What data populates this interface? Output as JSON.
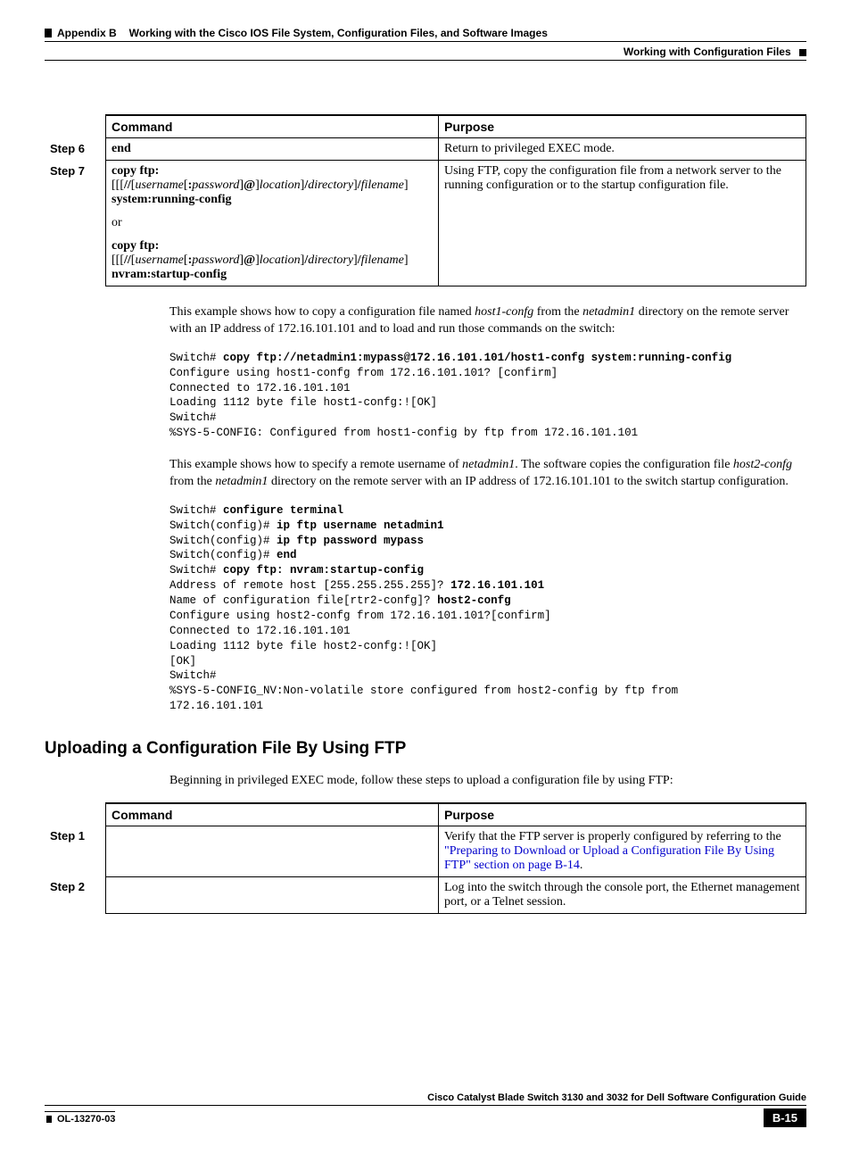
{
  "header": {
    "appendix": "Appendix B",
    "title": "Working with the Cisco IOS File System, Configuration Files, and Software Images",
    "section": "Working with Configuration Files"
  },
  "table1": {
    "headers": {
      "command": "Command",
      "purpose": "Purpose"
    },
    "rows": [
      {
        "step": "Step 6",
        "command_html": "<p><span class='bold'>end</span></p>",
        "purpose": "Return to privileged EXEC mode."
      },
      {
        "step": "Step 7",
        "command_html": "<p><span class='bold'>copy ftp:</span>[[[<span class='bold'>//</span>[<span class='italic'>username</span>[<span class='bold'>:</span><span class='italic'>password</span>]<span class='bold'>@</span>]<span class='italic'>location</span>]<span class='bold'>/</span><span class='italic'>directory</span>]<span class='bold'>/</span><span class='italic'>filename</span>] <span class='bold'>system:running-config</span></p><p>or</p><p><span class='bold'>copy ftp:</span>[[[<span class='bold'>//</span>[<span class='italic'>username</span>[<span class='bold'>:</span><span class='italic'>password</span>]<span class='bold'>@</span>]<span class='italic'>location</span>]<span class='bold'>/</span><span class='italic'>directory</span>]<span class='bold'>/</span><span class='italic'>filename</span>] <span class='bold'>nvram:startup-config</span></p>",
        "purpose": "Using FTP, copy the configuration file from a network server to the running configuration or to the startup configuration file."
      }
    ]
  },
  "para1_parts": {
    "p1": "This example shows how to copy a configuration file named ",
    "i1": "host1-confg",
    "p2": " from the ",
    "i2": "netadmin1",
    "p3": " directory on the remote server with an IP address of 172.16.101.101 and to load and run those commands on the switch:"
  },
  "code1": "Switch# <b>copy ftp://netadmin1:mypass@172.16.101.101/host1-confg system:running-config</b>\nConfigure using host1-confg from 172.16.101.101? [confirm]\nConnected to 172.16.101.101\nLoading 1112 byte file host1-confg:![OK]\nSwitch#\n%SYS-5-CONFIG: Configured from host1-config by ftp from 172.16.101.101",
  "para2_parts": {
    "p1": "This example shows how to specify a remote username of ",
    "i1": "netadmin1",
    "p2": ". The software copies the configuration file ",
    "i2": "host2-confg",
    "p3": " from the ",
    "i3": "netadmin1",
    "p4": " directory on the remote server with an IP address of 172.16.101.101 to the switch startup configuration."
  },
  "code2": "Switch# <b>configure terminal</b>\nSwitch(config)# <b>ip ftp username netadmin1</b>\nSwitch(config)# <b>ip ftp password mypass</b>\nSwitch(config)# <b>end</b>\nSwitch# <b>copy ftp: nvram:startup-config</b>\nAddress of remote host [255.255.255.255]? <b>172.16.101.101</b>\nName of configuration file[rtr2-confg]? <b>host2-confg</b>\nConfigure using host2-confg from 172.16.101.101?[confirm]\nConnected to 172.16.101.101\nLoading 1112 byte file host2-confg:![OK]\n[OK]\nSwitch#\n%SYS-5-CONFIG_NV:Non-volatile store configured from host2-config by ftp from\n172.16.101.101",
  "heading2": "Uploading a Configuration File By Using FTP",
  "para3": "Beginning in privileged EXEC mode, follow these steps to upload a configuration file by using FTP:",
  "table2": {
    "headers": {
      "command": "Command",
      "purpose": "Purpose"
    },
    "rows": [
      {
        "step": "Step 1",
        "command": "",
        "purpose_html": "Verify that the FTP server is properly configured by referring to the <span class='link'>\"Preparing to Download or Upload a Configuration File By Using FTP\" section on page B-14</span>."
      },
      {
        "step": "Step 2",
        "command": "",
        "purpose_html": "Log into the switch through the console port, the Ethernet management port, or a Telnet session."
      }
    ]
  },
  "footer": {
    "doc_title": "Cisco Catalyst Blade Switch 3130 and 3032 for Dell Software Configuration Guide",
    "doc_number": "OL-13270-03",
    "page": "B-15"
  },
  "chart_data": null
}
